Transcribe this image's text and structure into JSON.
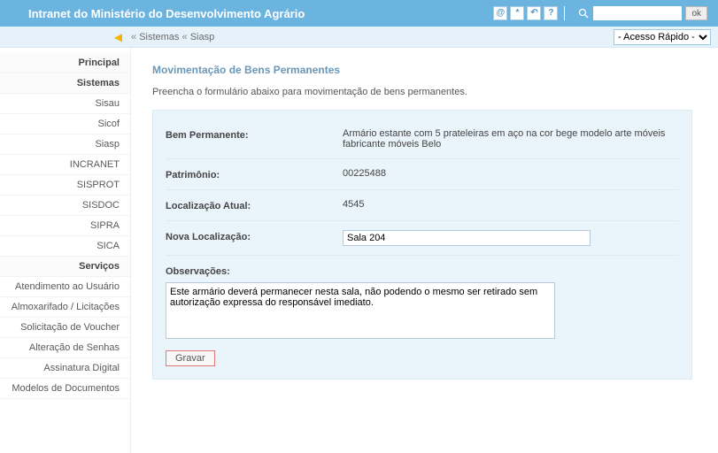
{
  "header": {
    "title": "Intranet do Ministério do Desenvolvimento Agrário",
    "search_ok": "ok"
  },
  "breadcrumb": {
    "items": [
      "Sistemas",
      "Siasp"
    ]
  },
  "quick_access": {
    "selected": "- Acesso Rápido -"
  },
  "sidebar": {
    "groups": [
      {
        "label": "Principal",
        "header": true
      },
      {
        "label": "Sistemas",
        "header": true
      },
      {
        "label": "Sisau"
      },
      {
        "label": "Sicof"
      },
      {
        "label": "Siasp"
      },
      {
        "label": "INCRANET"
      },
      {
        "label": "SISPROT"
      },
      {
        "label": "SISDOC"
      },
      {
        "label": "SIPRA"
      },
      {
        "label": "SICA"
      },
      {
        "label": "Serviços",
        "header": true
      },
      {
        "label": "Atendimento ao Usuário"
      },
      {
        "label": "Almoxarifado / Licitações"
      },
      {
        "label": "Solicitação de Voucher"
      },
      {
        "label": "Alteração de Senhas"
      },
      {
        "label": "Assinatura Digital"
      },
      {
        "label": "Modelos de Documentos"
      }
    ]
  },
  "main": {
    "title": "Movimentação de Bens Permanentes",
    "description": "Preencha o formulário abaixo para movimentação de bens permanentes.",
    "fields": {
      "bem_label": "Bem Permanente:",
      "bem_value": "Armário estante com 5 prateleiras em aço na cor bege modelo arte móveis fabricante móveis Belo",
      "patrimonio_label": "Patrimônio:",
      "patrimonio_value": "00225488",
      "localizacao_label": "Localização Atual:",
      "localizacao_value": "4545",
      "nova_loc_label": "Nova Localização:",
      "nova_loc_value": "Sala 204",
      "obs_label": "Observações:",
      "obs_value": "Este armário deverá permanecer nesta sala, não podendo o mesmo ser retirado sem autorização expressa do responsável imediato."
    },
    "save_label": "Gravar"
  }
}
